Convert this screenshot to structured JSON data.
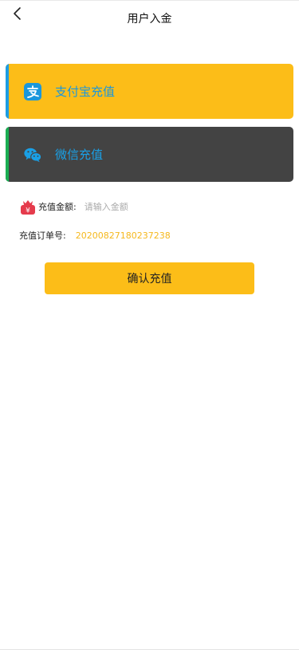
{
  "header": {
    "title": "用户入金"
  },
  "payment_methods": [
    {
      "label": "支付宝充值",
      "icon": "alipay-icon"
    },
    {
      "label": "微信充值",
      "icon": "wechat-icon"
    }
  ],
  "form": {
    "amount_label": "充值金额:",
    "amount_placeholder": "请输入金额",
    "order_label": "充值订单号:",
    "order_number": "20200827180237238"
  },
  "actions": {
    "confirm_label": "确认充值"
  },
  "colors": {
    "accent": "#fcbd18",
    "alipay_blue": "#1a97dc",
    "wechat_green": "#1aad52",
    "dark_card": "#434343",
    "order_number": "#f5b81c"
  }
}
